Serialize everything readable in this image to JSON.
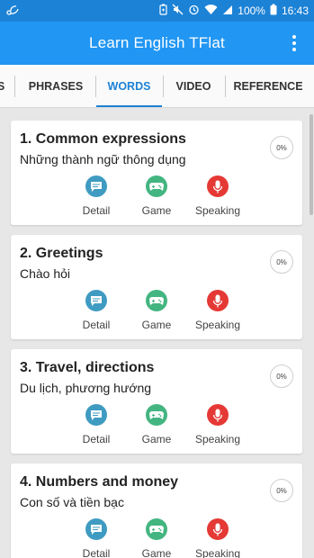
{
  "status": {
    "battery": "100%",
    "time": "16:43",
    "icons": [
      "wifi-sync-icon",
      "battery-saver-icon",
      "mute-icon",
      "alarm-icon",
      "wifi-icon",
      "signal-icon",
      "battery-icon"
    ]
  },
  "appbar": {
    "title": "Learn English TFlat",
    "menu_icon": "more-vert-icon"
  },
  "tabs": [
    {
      "label": "S"
    },
    {
      "label": "PHRASES"
    },
    {
      "label": "WORDS"
    },
    {
      "label": "VIDEO"
    },
    {
      "label": "REFERENCE"
    }
  ],
  "lessons": [
    {
      "title": "1. Common expressions",
      "subtitle": "Những thành ngữ thông dụng",
      "progress": "0%",
      "detail": "Detail",
      "game": "Game",
      "speaking": "Speaking"
    },
    {
      "title": "2. Greetings",
      "subtitle": "Chào hỏi",
      "progress": "0%",
      "detail": "Detail",
      "game": "Game",
      "speaking": "Speaking"
    },
    {
      "title": "3. Travel, directions",
      "subtitle": "Du lịch, phương hướng",
      "progress": "0%",
      "detail": "Detail",
      "game": "Game",
      "speaking": "Speaking"
    },
    {
      "title": "4. Numbers and money",
      "subtitle": "Con số và tiền bạc",
      "progress": "0%",
      "detail": "Detail",
      "game": "Game",
      "speaking": "Speaking"
    }
  ],
  "colors": {
    "statusbar": "#1c82d6",
    "appbar": "#2196f3",
    "active_tab": "#1c82d6",
    "detail_icon": "#3f9bc1",
    "game_icon": "#43b581",
    "speaking_icon": "#e53935"
  }
}
